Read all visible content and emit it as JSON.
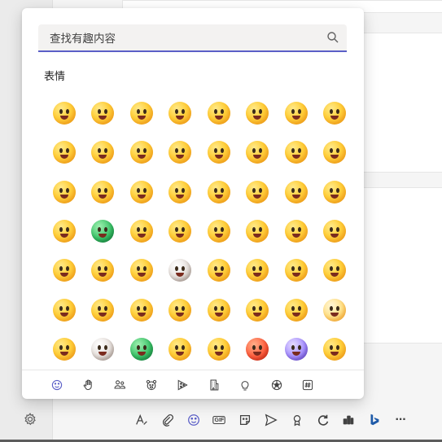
{
  "search": {
    "placeholder": "查找有趣内容",
    "value": ""
  },
  "section": {
    "title": "表情"
  },
  "emojis": [
    {
      "name": "grinning-face",
      "style": ""
    },
    {
      "name": "grinning-face-big-eyes",
      "style": ""
    },
    {
      "name": "beaming-face",
      "style": ""
    },
    {
      "name": "grinning-squinting-face",
      "style": ""
    },
    {
      "name": "grinning-face-sweat",
      "style": ""
    },
    {
      "name": "rolling-on-floor-laughing",
      "style": ""
    },
    {
      "name": "face-with-tears-of-joy",
      "style": ""
    },
    {
      "name": "slightly-smiling-face",
      "style": ""
    },
    {
      "name": "upside-down-face",
      "style": ""
    },
    {
      "name": "winking-face",
      "style": ""
    },
    {
      "name": "smiling-face-smiling-eyes",
      "style": ""
    },
    {
      "name": "smiling-face-with-halo",
      "style": ""
    },
    {
      "name": "smiling-face-with-hearts",
      "style": ""
    },
    {
      "name": "heart-eyes",
      "style": ""
    },
    {
      "name": "star-struck",
      "style": ""
    },
    {
      "name": "face-blowing-kiss",
      "style": ""
    },
    {
      "name": "kissing-face",
      "style": ""
    },
    {
      "name": "smiling-face",
      "style": ""
    },
    {
      "name": "kissing-face-closed-eyes",
      "style": ""
    },
    {
      "name": "kissing-face-smiling-eyes",
      "style": ""
    },
    {
      "name": "face-savoring-food",
      "style": ""
    },
    {
      "name": "face-with-tongue",
      "style": ""
    },
    {
      "name": "winking-face-tongue",
      "style": ""
    },
    {
      "name": "zany-face",
      "style": ""
    },
    {
      "name": "squinting-face-tongue",
      "style": ""
    },
    {
      "name": "money-mouth-face",
      "style": "green"
    },
    {
      "name": "hugging-face",
      "style": ""
    },
    {
      "name": "face-with-hand-over-mouth",
      "style": ""
    },
    {
      "name": "shushing-face",
      "style": ""
    },
    {
      "name": "thinking-face",
      "style": ""
    },
    {
      "name": "zipper-mouth-face",
      "style": ""
    },
    {
      "name": "face-raised-eyebrow",
      "style": ""
    },
    {
      "name": "neutral-face",
      "style": ""
    },
    {
      "name": "expressionless-face",
      "style": ""
    },
    {
      "name": "face-without-mouth",
      "style": ""
    },
    {
      "name": "face-in-clouds",
      "style": "grey"
    },
    {
      "name": "smirking-face",
      "style": ""
    },
    {
      "name": "unamused-face",
      "style": ""
    },
    {
      "name": "face-rolling-eyes",
      "style": ""
    },
    {
      "name": "grimacing-face",
      "style": ""
    },
    {
      "name": "face-exhaling",
      "style": ""
    },
    {
      "name": "lying-face",
      "style": ""
    },
    {
      "name": "relieved-face",
      "style": ""
    },
    {
      "name": "pensive-face",
      "style": ""
    },
    {
      "name": "sleepy-face",
      "style": ""
    },
    {
      "name": "drooling-face",
      "style": ""
    },
    {
      "name": "sleeping-face",
      "style": ""
    },
    {
      "name": "face-with-medical-mask",
      "style": "pale"
    },
    {
      "name": "face-with-thermometer",
      "style": ""
    },
    {
      "name": "face-with-head-bandage",
      "style": "grey"
    },
    {
      "name": "nauseated-face",
      "style": "green"
    },
    {
      "name": "vomiting-face",
      "style": ""
    },
    {
      "name": "sneezing-face",
      "style": ""
    },
    {
      "name": "hot-face",
      "style": "red"
    },
    {
      "name": "cold-face",
      "style": "purple"
    },
    {
      "name": "woozy-face",
      "style": ""
    }
  ],
  "tabs": [
    {
      "name": "smiley-icon",
      "active": true
    },
    {
      "name": "hand-icon",
      "active": false
    },
    {
      "name": "people-icon",
      "active": false
    },
    {
      "name": "animal-icon",
      "active": false
    },
    {
      "name": "food-icon",
      "active": false
    },
    {
      "name": "building-icon",
      "active": false
    },
    {
      "name": "lightbulb-icon",
      "active": false
    },
    {
      "name": "soccer-ball-icon",
      "active": false
    },
    {
      "name": "hashtag-icon",
      "active": false
    }
  ],
  "toolbar": {
    "items": [
      "format-icon",
      "attach-icon",
      "emoji-icon",
      "gif-icon",
      "sticker-icon",
      "schedule-send-icon",
      "praise-icon",
      "loop-icon",
      "viva-icon",
      "bing-icon",
      "more-icon"
    ],
    "gif_label": "GIF",
    "more_label": "···"
  },
  "colors": {
    "accent": "#5b5fc7",
    "panel_bg": "#ffffff",
    "search_bg": "#f3f2f1"
  }
}
